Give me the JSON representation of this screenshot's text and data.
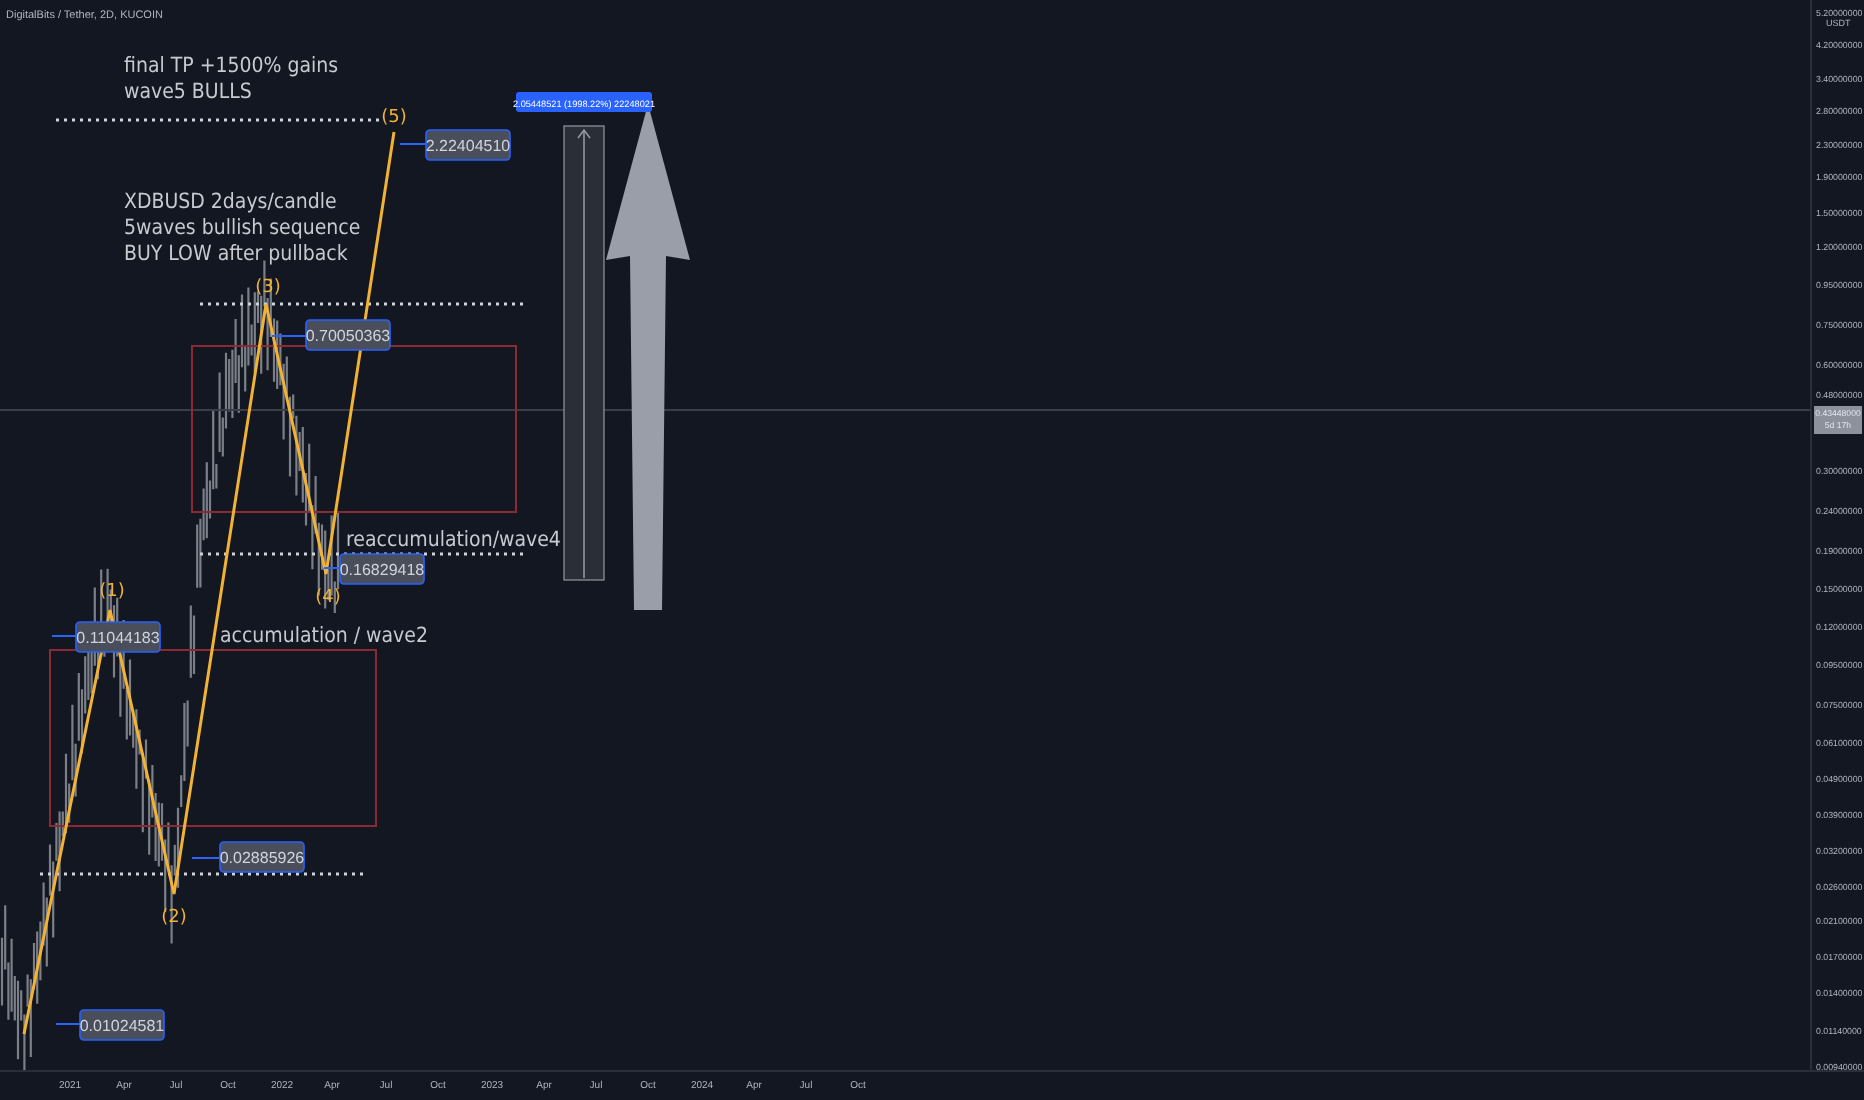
{
  "symbol_title": "DigitalBits / Tether, 2D, KUCOIN",
  "notes": [
    {
      "lines": [
        "final TP +1500% gains",
        "wave5 BULLS"
      ]
    },
    {
      "lines": [
        "XDBUSD 2days/candle",
        "5waves bullish sequence",
        "BUY LOW after pullback"
      ]
    },
    {
      "lines": [
        "reaccumulation/wave4"
      ]
    },
    {
      "lines": [
        "accumulation / wave2"
      ]
    }
  ],
  "wave_labels": [
    "(1)",
    "(2)",
    "(3)",
    "(4)",
    "(5)"
  ],
  "price_labels": [
    "2.22404510",
    "0.70050363",
    "0.16829418",
    "0.11044183",
    "0.02885926",
    "0.01024581"
  ],
  "measure_label": "2.05448521 (1998.22%) 22248021",
  "price_axis": {
    "currency": "USDT",
    "ticks": [
      "5.20000000",
      "4.20000000",
      "3.40000000",
      "2.80000000",
      "2.30000000",
      "1.90000000",
      "1.50000000",
      "1.20000000",
      "0.95000000",
      "0.75000000",
      "0.60000000",
      "0.48000000",
      "0.30000000",
      "0.24000000",
      "0.19000000",
      "0.15000000",
      "0.12000000",
      "0.09500000",
      "0.07500000",
      "0.06100000",
      "0.04900000",
      "0.03900000",
      "0.03200000",
      "0.02600000",
      "0.02100000",
      "0.01700000",
      "0.01400000",
      "0.01140000",
      "0.00940000"
    ]
  },
  "last_price": {
    "price": "0.43448000",
    "countdown": "5d 17h"
  },
  "time_axis": [
    "2021",
    "Apr",
    "Jul",
    "Oct",
    "2022",
    "Apr",
    "Jul",
    "Oct",
    "2023",
    "Apr",
    "Jul",
    "Oct",
    "2024",
    "Apr",
    "Jul",
    "Oct"
  ]
}
